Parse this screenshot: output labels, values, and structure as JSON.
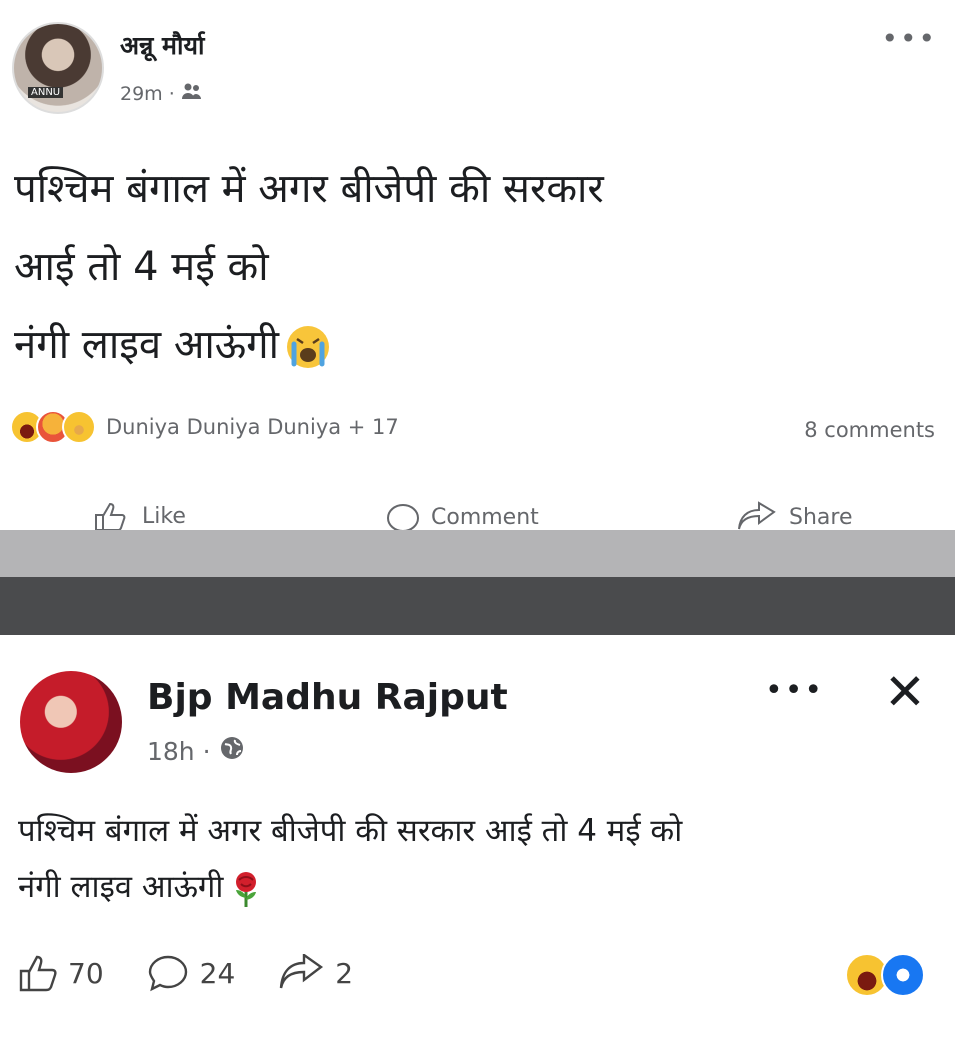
{
  "post1": {
    "author": "अन्नू मौर्या",
    "time": "29m",
    "audience_icon": "friends-icon",
    "text_lines": [
      "पश्चिम बंगाल में अगर बीजेपी की सरकार",
      "आई तो 4 मई को",
      "नंगी लाइव आऊंगी"
    ],
    "reaction_names": "Duniya Duniya Duniya + 17",
    "comments": "8 comments",
    "actions": {
      "like": "Like",
      "comment": "Comment",
      "share": "Share"
    }
  },
  "post2": {
    "author": "Bjp Madhu Rajput",
    "time": "18h",
    "audience_icon": "globe-icon",
    "text_lines": [
      "पश्चिम बंगाल में अगर बीजेपी की सरकार आई तो 4 मई को",
      "नंगी लाइव आऊंगी"
    ],
    "likes": "70",
    "comments": "24",
    "shares": "2"
  },
  "colors": {
    "secondary_text": "#65676b",
    "separator_light": "#b4b4b6",
    "separator_dark": "#4a4b4d",
    "like_blue": "#1877f2"
  }
}
